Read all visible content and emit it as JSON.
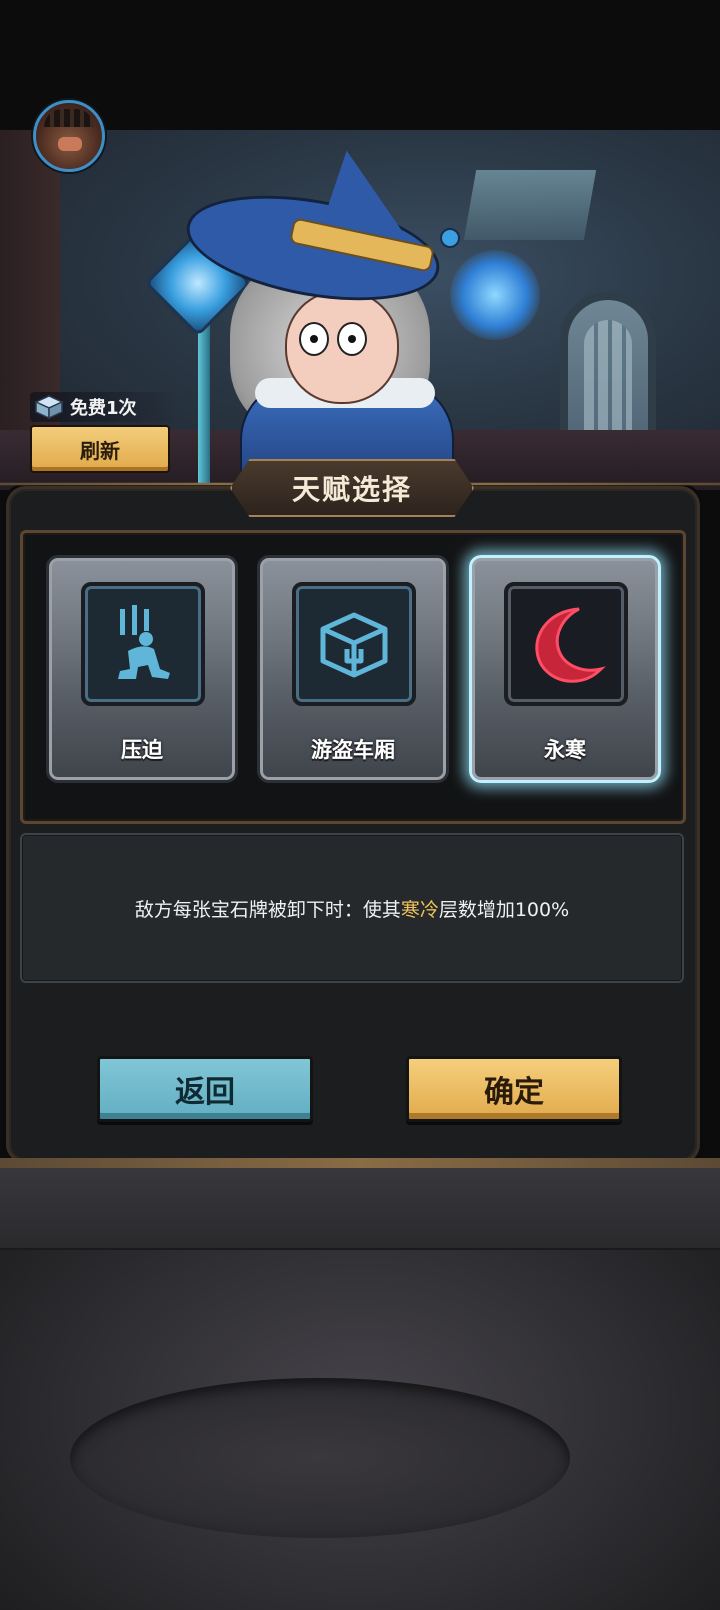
{
  "free_refresh": {
    "label": "免费1次",
    "icon": "gem-cube-icon"
  },
  "refresh_button": {
    "label": "刷新"
  },
  "panel": {
    "title": "天赋选择"
  },
  "talents": [
    {
      "label": "压迫",
      "icon": "kneeling-figure-icon",
      "selected": false
    },
    {
      "label": "游盗车厢",
      "icon": "chest-icon",
      "selected": false
    },
    {
      "label": "永寒",
      "icon": "crescent-moon-icon",
      "selected": true
    }
  ],
  "description": {
    "before": "敌方每张宝石牌被卸下时：使其",
    "highlight": "寒冷",
    "after": "层数增加100%"
  },
  "buttons": {
    "back": "返回",
    "confirm": "确定"
  },
  "colors": {
    "highlight": "#f0c25b",
    "back_button": "#6fb8cb",
    "confirm_button": "#e9b85e",
    "selected_glow": "#bff1ff"
  }
}
